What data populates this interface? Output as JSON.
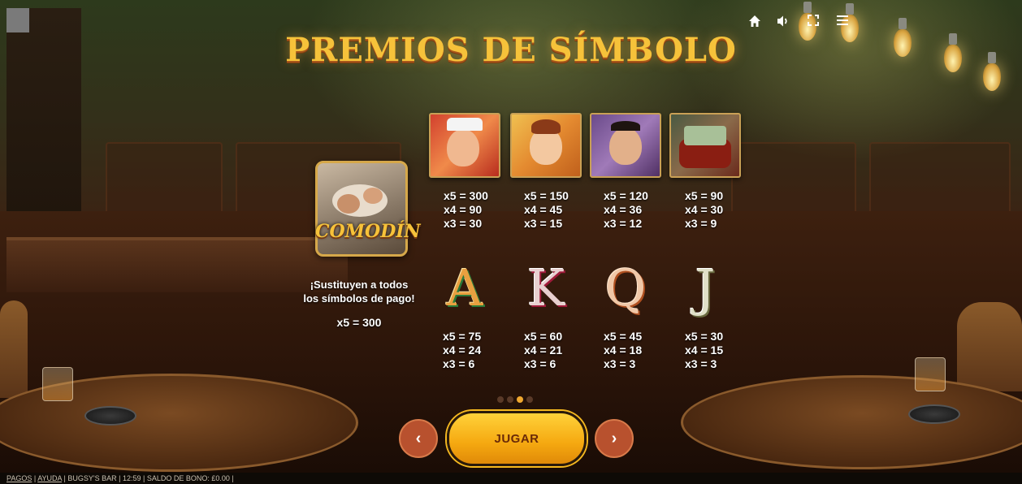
{
  "title": "PREMIOS DE SÍMBOLO",
  "hud": {
    "icons": [
      "home-icon",
      "sound-icon",
      "fullscreen-icon",
      "menu-icon"
    ]
  },
  "wild": {
    "label": "COMODÍN",
    "description_line1": "¡Sustituyen a todos",
    "description_line2": "los símbolos de pago!",
    "pay": "x5 = 300"
  },
  "symbols_row1": [
    {
      "name": "gangster-fat",
      "p5": "x5 = 300",
      "p4": "x4 = 90",
      "p3": "x3 = 30"
    },
    {
      "name": "woman-with-gun",
      "p5": "x5 = 150",
      "p4": "x4 = 45",
      "p3": "x3 = 15"
    },
    {
      "name": "gangster-knife",
      "p5": "x5 = 120",
      "p4": "x4 = 36",
      "p3": "x3 = 12"
    },
    {
      "name": "money-bag",
      "p5": "x5 = 90",
      "p4": "x4 = 30",
      "p3": "x3 = 9"
    }
  ],
  "symbols_row2": [
    {
      "letter": "A",
      "p5": "x5 = 75",
      "p4": "x4 = 24",
      "p3": "x3 = 6"
    },
    {
      "letter": "K",
      "p5": "x5 = 60",
      "p4": "x4 = 21",
      "p3": "x3 = 6"
    },
    {
      "letter": "Q",
      "p5": "x5 = 45",
      "p4": "x4 = 18",
      "p3": "x3 = 3"
    },
    {
      "letter": "J",
      "p5": "x5 = 30",
      "p4": "x4 = 15",
      "p3": "x3 = 3"
    }
  ],
  "pagination": {
    "total": 4,
    "active": 3
  },
  "buttons": {
    "prev": "‹",
    "next": "›",
    "play": "JUGAR"
  },
  "footer": {
    "pagos": "PAGOS",
    "ayuda": "AYUDA",
    "game": "BUGSY'S BAR",
    "time": "12:59",
    "bonus": "SALDO DE BONO: £0.00"
  },
  "colors": {
    "title_gold": "#f6c23a",
    "play_button": "#f5a810",
    "nav_button": "#b8512e"
  }
}
